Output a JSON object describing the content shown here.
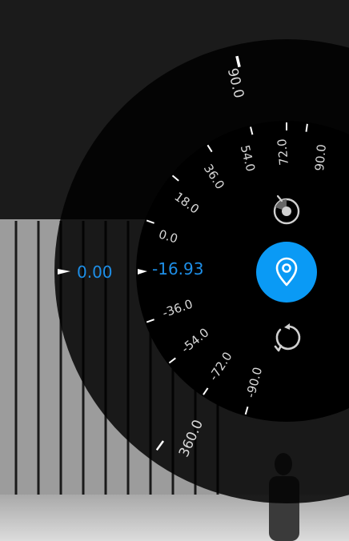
{
  "readouts": {
    "outer_value": "0.00",
    "inner_value": "-16.93"
  },
  "outer_ring": {
    "labels": [
      "90.0",
      "360.0"
    ]
  },
  "inner_ring": {
    "labels": [
      "90.0",
      "72.0",
      "54.0",
      "36.0",
      "18.0",
      "0.0",
      "-36.0",
      "-54.0",
      "-72.0",
      "-90.0"
    ]
  },
  "controls": {
    "level_icon": "tilt-level-icon",
    "location_icon": "location-pin-icon",
    "reset_icon": "rotate-reset-icon"
  },
  "colors": {
    "accent": "#0a9af5",
    "readout_text": "#1e8fe8",
    "dial_label": "#d8d8d8"
  }
}
